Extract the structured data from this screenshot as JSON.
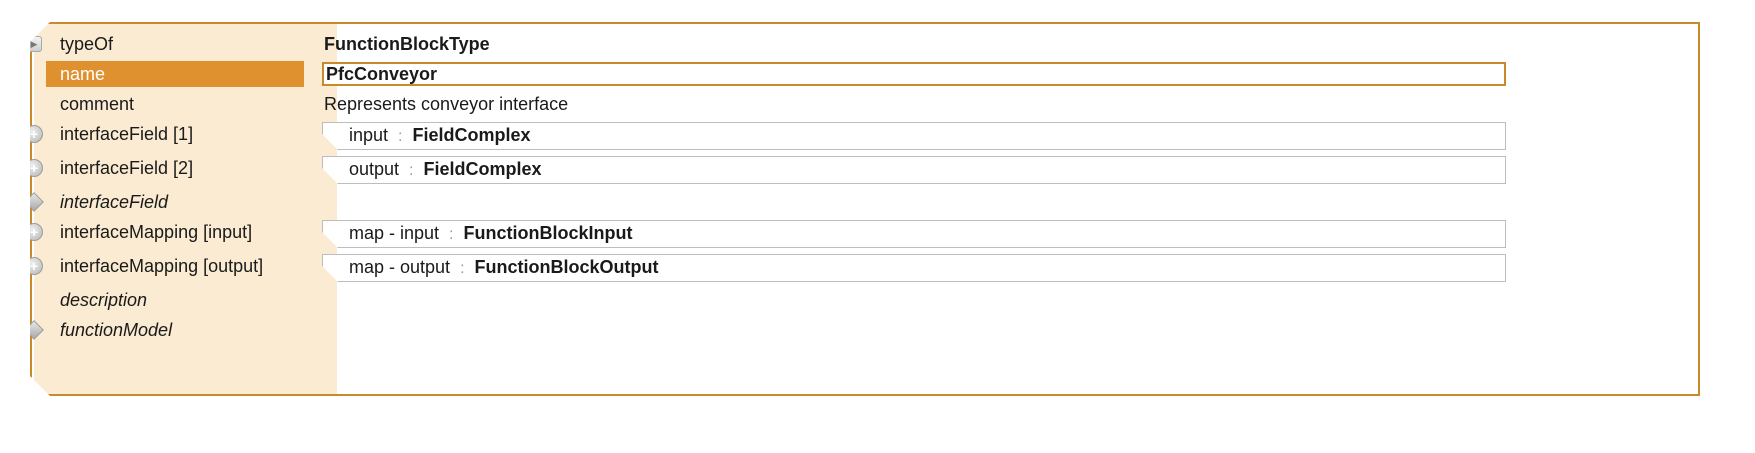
{
  "rows": [
    {
      "label": "typeOf",
      "expander": "triangle-icon"
    },
    {
      "label": "name",
      "expander": "none"
    },
    {
      "label": "comment",
      "expander": "none"
    },
    {
      "label": "interfaceField [1]",
      "expander": "plus-circle-icon"
    },
    {
      "label": "interfaceField [2]",
      "expander": "plus-circle-icon"
    },
    {
      "label": "interfaceField",
      "expander": "diamond-icon"
    },
    {
      "label": "interfaceMapping [input]",
      "expander": "plus-circle-icon"
    },
    {
      "label": "interfaceMapping [output]",
      "expander": "plus-circle-icon"
    },
    {
      "label": "description",
      "expander": "none"
    },
    {
      "label": "functionModel",
      "expander": "diamond-icon"
    }
  ],
  "values": {
    "typeOf": "FunctionBlockType",
    "name": "PfcConveyor",
    "comment": "Represents conveyor interface",
    "field1": {
      "name": "input",
      "sep": ":",
      "type": "FieldComplex"
    },
    "field2": {
      "name": "output",
      "sep": ":",
      "type": "FieldComplex"
    },
    "map_input": {
      "name": "map - input",
      "sep": ":",
      "type": "FunctionBlockInput"
    },
    "map_output": {
      "name": "map - output",
      "sep": ":",
      "type": "FunctionBlockOutput"
    }
  },
  "colors": {
    "accent": "#e0912f",
    "border": "#c98a2b",
    "panel": "#faebd2"
  }
}
